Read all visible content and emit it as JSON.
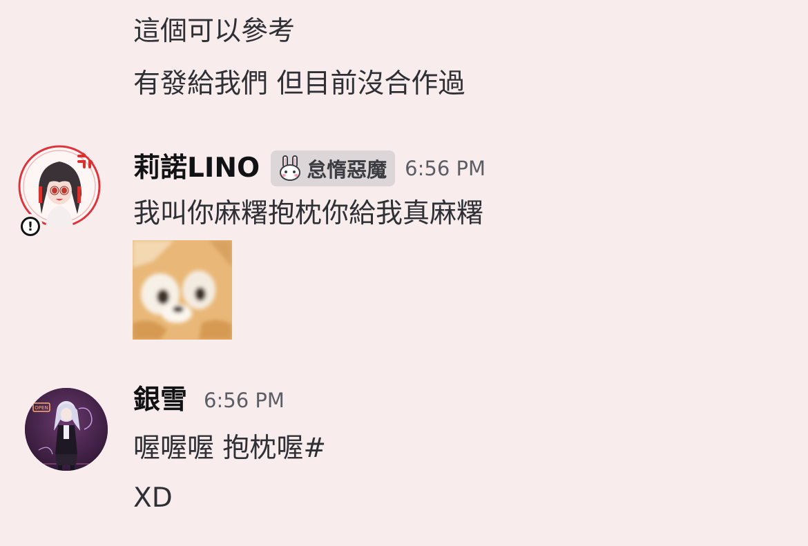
{
  "messages": {
    "continuation": {
      "line1": "這個可以參考",
      "line2": "有發給我們 但目前沒合作過"
    },
    "lino": {
      "username": "莉諾LINO",
      "role_tag": "怠惰惡魔",
      "role_icon": "bunny-icon",
      "timestamp": "6:56 PM",
      "text": "我叫你麻糬抱枕你給我真麻糬",
      "sticker": "cat-face-sticker"
    },
    "yinxue": {
      "username": "銀雪",
      "timestamp": "6:56 PM",
      "line1": "喔喔喔 抱枕喔#",
      "line2": "XD"
    }
  },
  "colors": {
    "background": "#f8ecec",
    "text": "#2e3035",
    "username": "#111214",
    "timestamp": "#5c5e66",
    "role_tag_bg": "#dcd6d8",
    "avatar_ring": "#e0323a"
  }
}
